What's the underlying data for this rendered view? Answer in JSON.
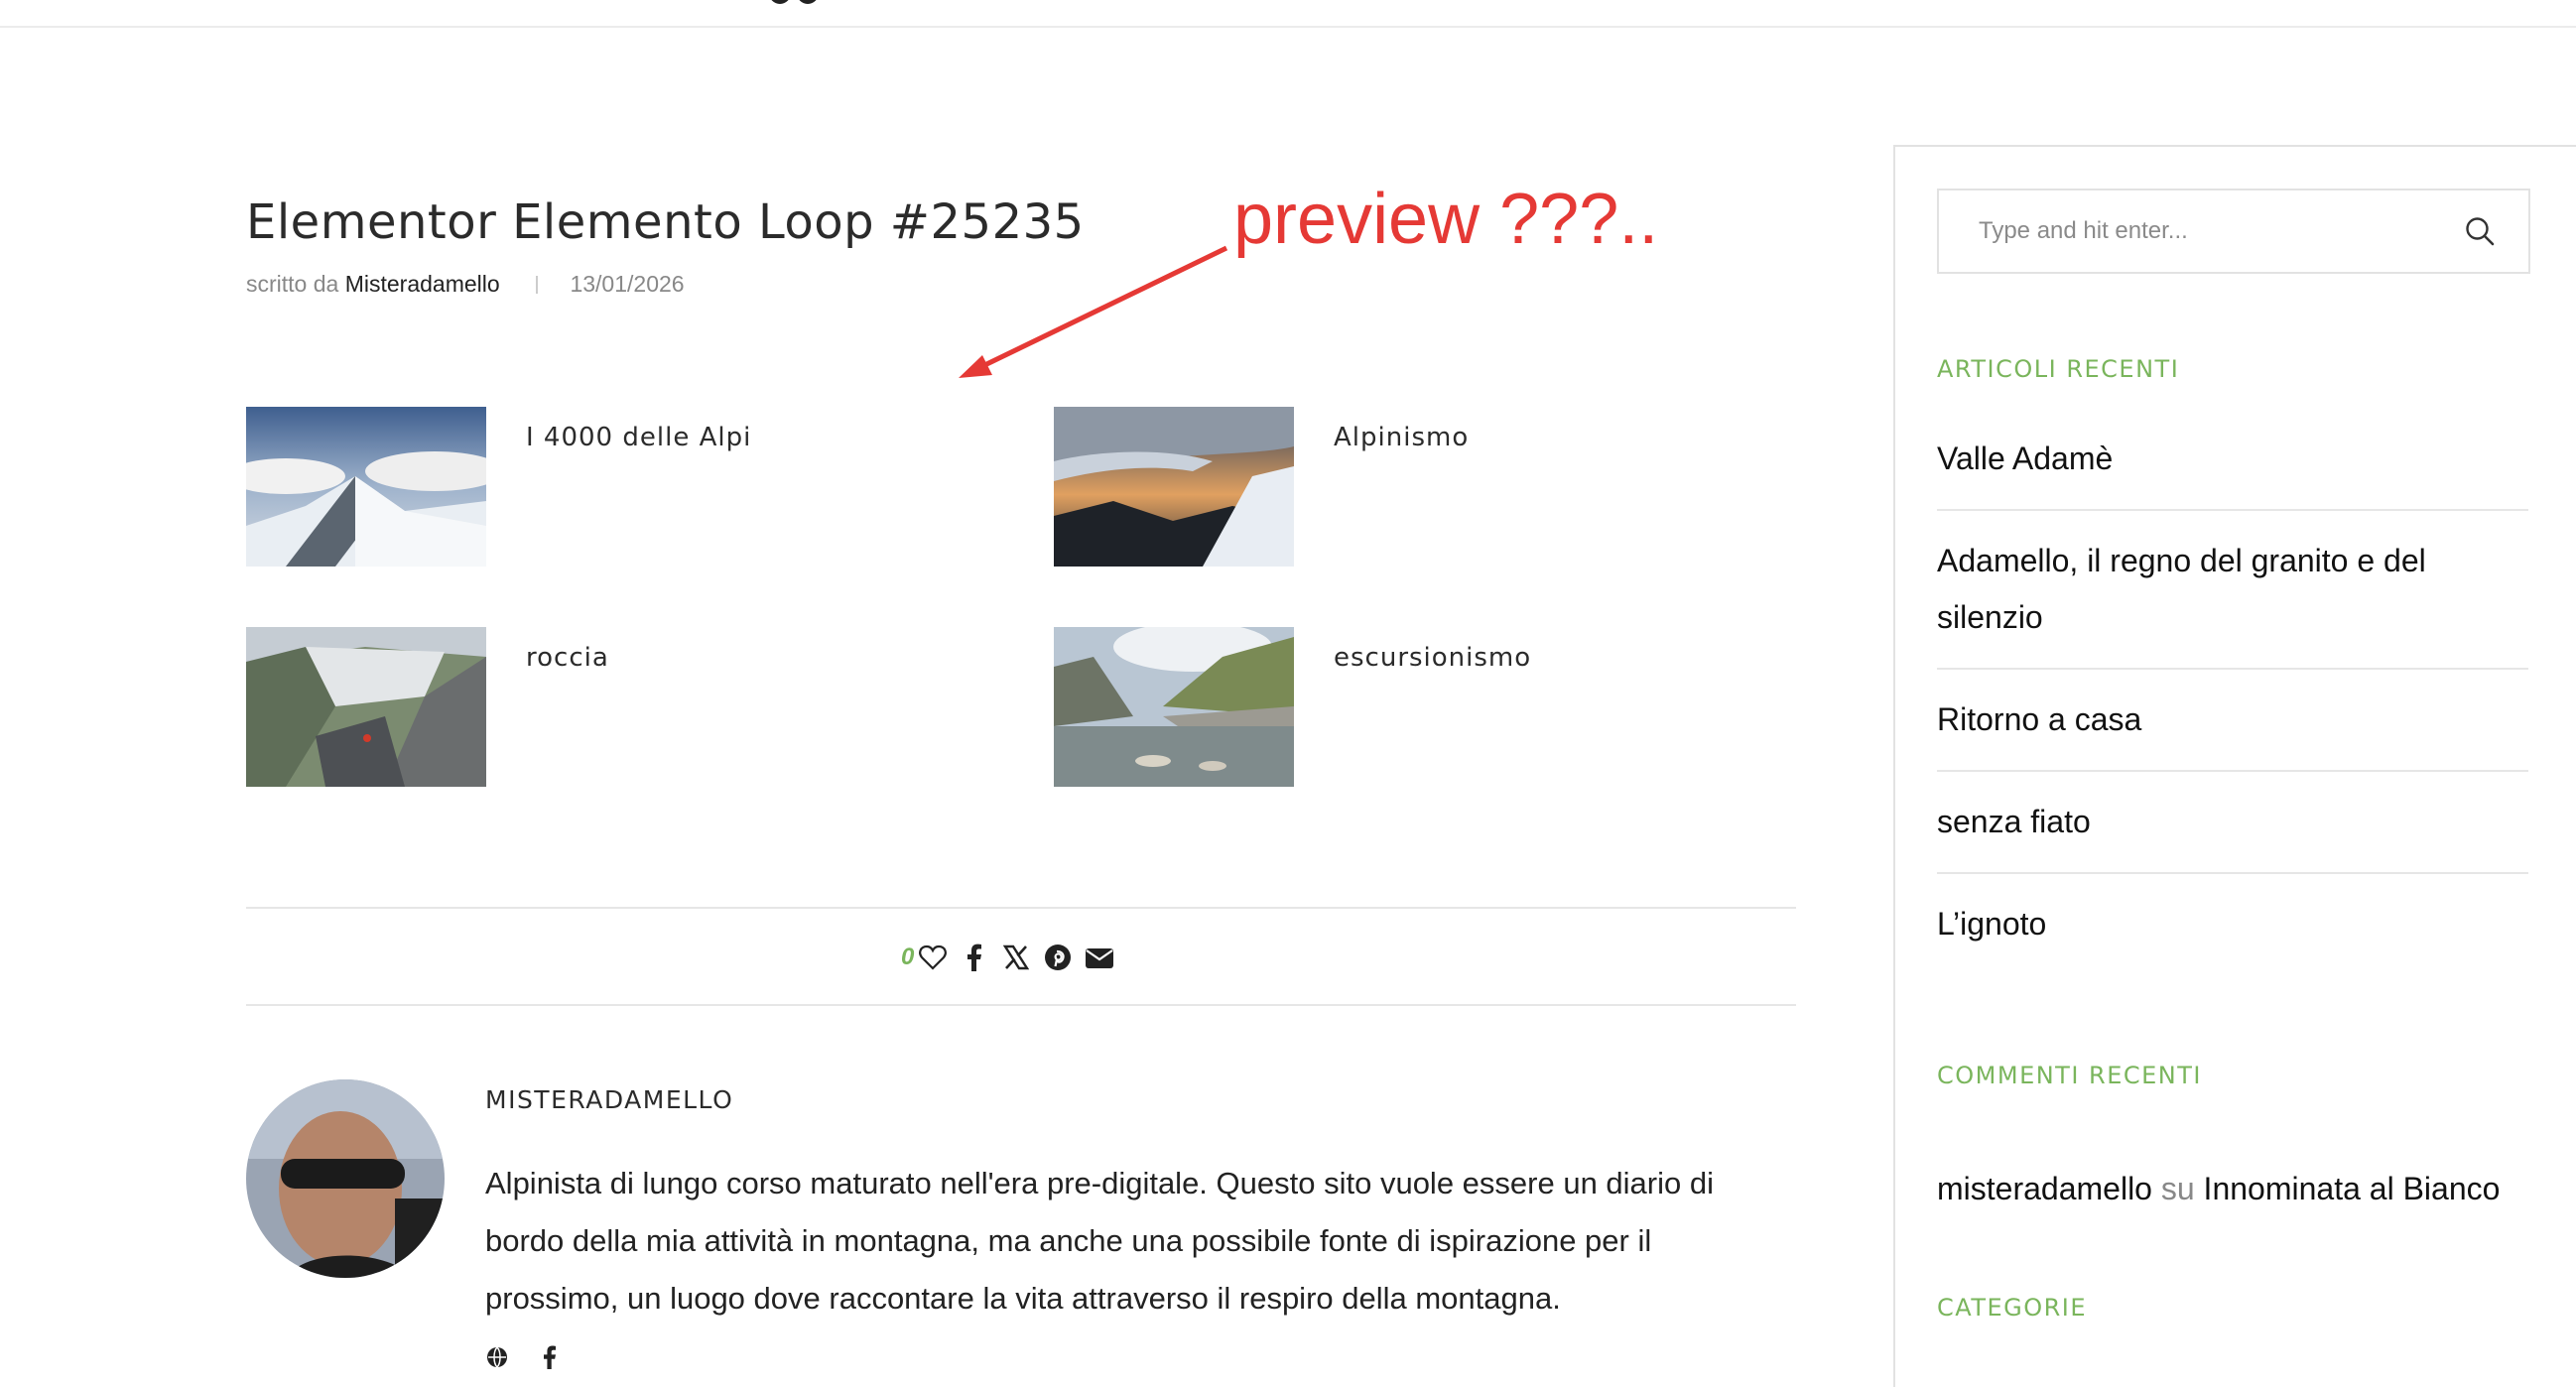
{
  "post": {
    "title": "Elementor Elemento Loop #25235",
    "meta_prefix": "scritto da",
    "author": "Misteradamello",
    "date": "13/01/2026"
  },
  "annotation": {
    "text": "preview ???..",
    "color": "#e53935"
  },
  "loop_items": [
    {
      "label": "I 4000 delle Alpi",
      "image": "snowy-ridge-photo"
    },
    {
      "label": "Alpinismo",
      "image": "ice-cornice-sunset-photo"
    },
    {
      "label": "roccia",
      "image": "rock-climbing-photo"
    },
    {
      "label": "escursionismo",
      "image": "alpine-lake-photo"
    }
  ],
  "share": {
    "like_count": "0",
    "icons": [
      "heart-icon",
      "facebook-icon",
      "x-icon",
      "pinterest-icon",
      "email-icon"
    ]
  },
  "author_box": {
    "name": "MISTERADAMELLO",
    "bio": "Alpinista di lungo corso maturato nell'era pre-digitale. Questo sito vuole essere un diario di bordo della mia attività in montagna, ma anche una possibile fonte di ispirazione per il prossimo, un luogo dove raccontare la vita attraverso il respiro della montagna.",
    "social_icons": [
      "globe-icon",
      "facebook-icon"
    ]
  },
  "sidebar": {
    "search_placeholder": "Type and hit enter...",
    "recent_title": "ARTICOLI RECENTI",
    "recent_posts": [
      "Valle Adamè",
      "Adamello, il regno del granito e del silenzio",
      "Ritorno a casa",
      "senza fiato",
      "L’ignoto"
    ],
    "comments_title": "COMMENTI RECENTI",
    "comment": {
      "author": "misteradamello",
      "connector": "su",
      "post": "Innominata al Bianco"
    },
    "categories_title": "CATEGORIE"
  },
  "colors": {
    "accent": "#7ab55c",
    "annotation": "#e53935",
    "text": "#222222"
  }
}
